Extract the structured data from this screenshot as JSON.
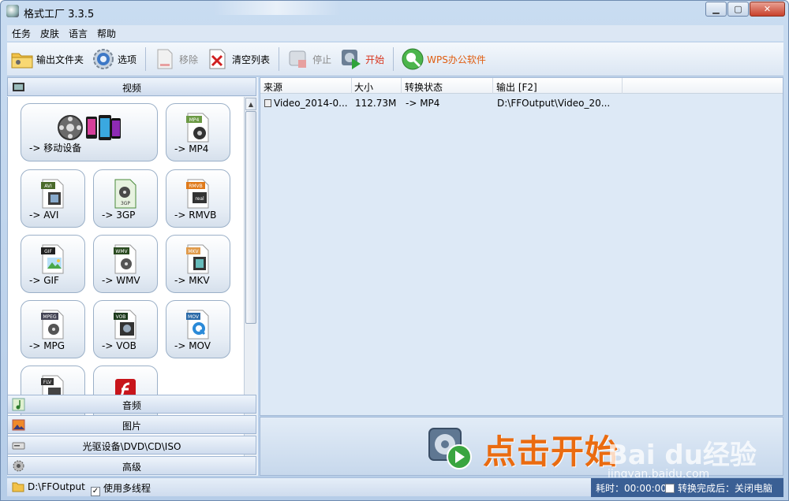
{
  "window": {
    "title": "格式工厂 3.3.5",
    "buttons": [
      "minimize",
      "maximize",
      "close"
    ]
  },
  "menubar": {
    "items": [
      "任务",
      "皮肤",
      "语言",
      "帮助"
    ]
  },
  "toolbar": {
    "output_folder": "输出文件夹",
    "options": "选项",
    "remove": "移除",
    "clear_list": "清空列表",
    "stop": "停止",
    "start": "开始",
    "wps": "WPS办公软件"
  },
  "left_panel": {
    "categories": {
      "video": "视频",
      "audio": "音频",
      "picture": "图片",
      "rom": "光驱设备\\DVD\\CD\\ISO",
      "advanced": "高级"
    },
    "formats": [
      {
        "label": "-> 移动设备",
        "icon": "mobile-devices-icon"
      },
      {
        "label": "-> MP4",
        "icon": "mp4-icon",
        "tag": "MP4"
      },
      {
        "label": "-> AVI",
        "icon": "avi-icon",
        "tag": "AVI"
      },
      {
        "label": "-> 3GP",
        "icon": "3gp-icon",
        "tag": "3GP"
      },
      {
        "label": "-> RMVB",
        "icon": "rmvb-icon",
        "tag": "RMVB"
      },
      {
        "label": "-> GIF",
        "icon": "gif-icon",
        "tag": "GIF"
      },
      {
        "label": "-> WMV",
        "icon": "wmv-icon",
        "tag": "WMV"
      },
      {
        "label": "-> MKV",
        "icon": "mkv-icon",
        "tag": "MKV"
      },
      {
        "label": "-> MPG",
        "icon": "mpg-icon",
        "tag": "MPEG"
      },
      {
        "label": "-> VOB",
        "icon": "vob-icon",
        "tag": "VOB"
      },
      {
        "label": "-> MOV",
        "icon": "mov-icon",
        "tag": "MOV"
      },
      {
        "label": "",
        "icon": "flv-icon",
        "tag": "FLV"
      },
      {
        "label": "",
        "icon": "swf-icon",
        "tag": ""
      }
    ]
  },
  "task_list": {
    "columns": [
      "来源",
      "大小",
      "转换状态",
      "输出 [F2]"
    ],
    "rows": [
      {
        "source": "Video_2014-0...",
        "size": "112.73M",
        "status": "-> MP4",
        "output": "D:\\FFOutput\\Video_20..."
      }
    ]
  },
  "start_area": {
    "label": "点击开始",
    "watermark": "Bai du经验",
    "watermark_url": "jingyan.baidu.com"
  },
  "statusbar": {
    "output_path": "D:\\FFOutput",
    "multithread_label": "使用多线程",
    "multithread_checked": "✓",
    "elapsed": "耗时：00:00:00",
    "after_label": "转换完成后：关闭电脑"
  },
  "colors": {
    "accent_orange": "#ea6b10",
    "start_red": "#d8341c",
    "statusbar_blue": "#3a5f94"
  }
}
